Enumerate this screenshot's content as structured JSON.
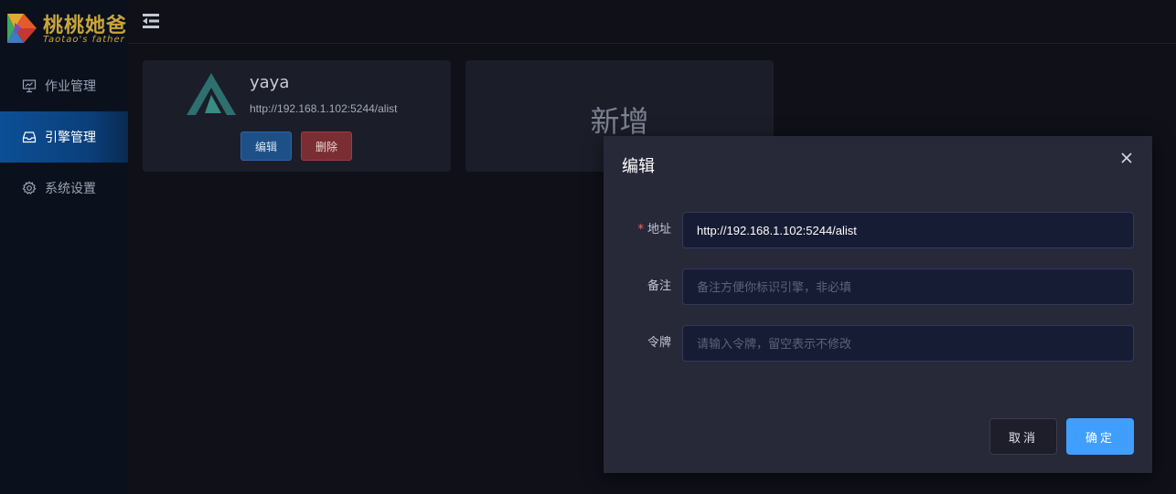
{
  "brand": {
    "title": "桃桃她爸",
    "subtitle": "Taotao's father"
  },
  "sidebar": {
    "items": [
      {
        "label": "作业管理",
        "icon": "presentation-icon"
      },
      {
        "label": "引擎管理",
        "icon": "inbox-icon",
        "active": true
      },
      {
        "label": "系统设置",
        "icon": "gear-icon"
      }
    ]
  },
  "cards": [
    {
      "name": "yaya",
      "url": "http://192.168.1.102:5244/alist",
      "edit_label": "编辑",
      "delete_label": "删除"
    }
  ],
  "add_card": {
    "label": "新增"
  },
  "modal": {
    "title": "编辑",
    "fields": [
      {
        "label": "地址",
        "required": true,
        "value": "http://192.168.1.102:5244/alist",
        "placeholder": ""
      },
      {
        "label": "备注",
        "required": false,
        "value": "",
        "placeholder": "备注方便你标识引擎，非必填"
      },
      {
        "label": "令牌",
        "required": false,
        "value": "",
        "placeholder": "请输入令牌，留空表示不修改"
      }
    ],
    "cancel_label": "取消",
    "confirm_label": "确定",
    "required_mark": "*"
  },
  "colors": {
    "accent": "#409eff",
    "sidebar_active": "#0c4f96",
    "danger": "#7a2d33",
    "brand_gold": "#c9a53a"
  }
}
